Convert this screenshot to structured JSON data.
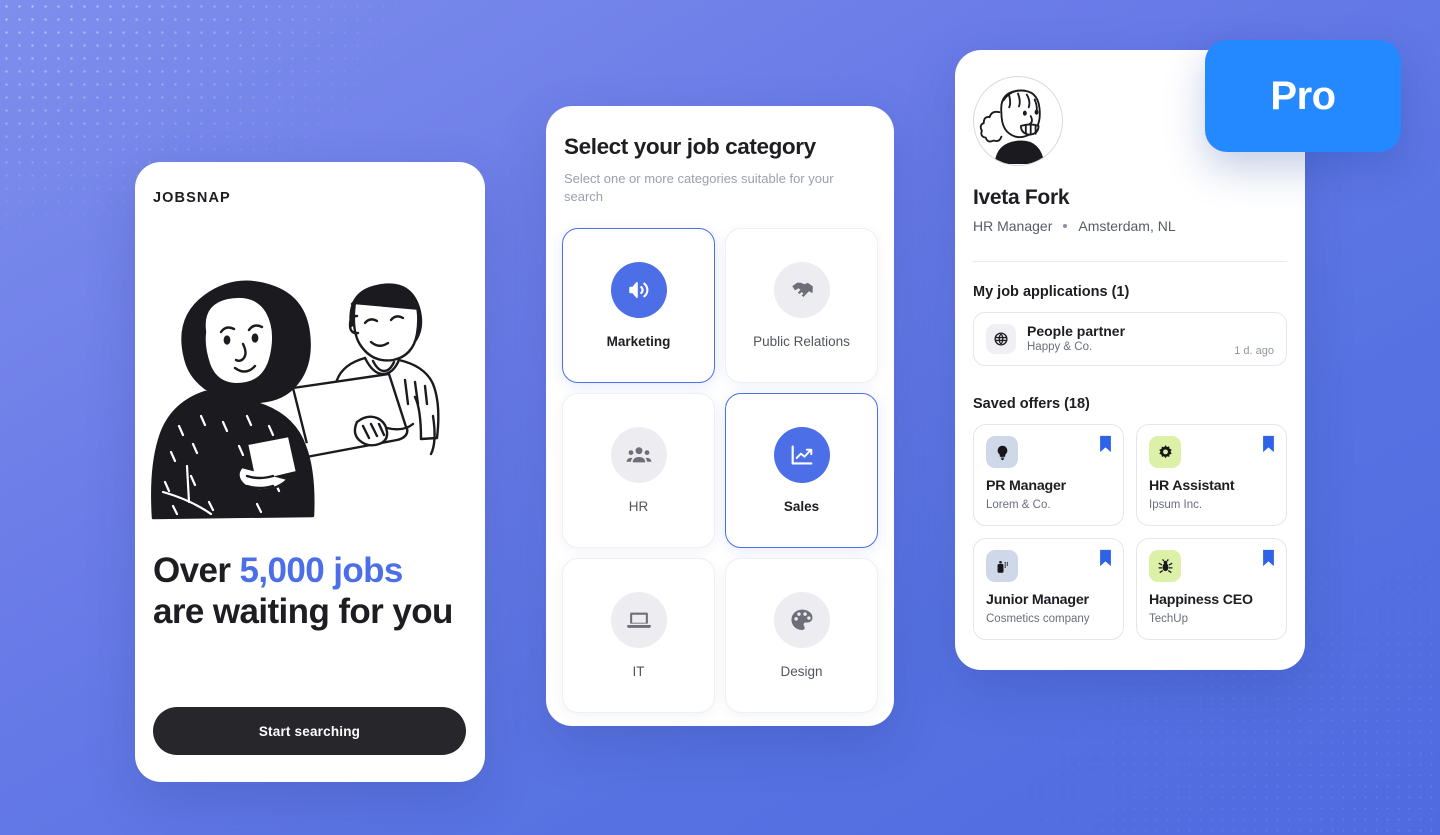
{
  "background": {
    "color_top": "#7E8EEC",
    "color_bottom": "#4F6ADF"
  },
  "onboarding_panel": {
    "brand": "JOBSNAP",
    "illustration_name": "two-people-with-laptop-illustration",
    "headline_before": "Over ",
    "headline_highlight": "5,000 jobs",
    "headline_after": " are waiting for you",
    "headline_highlight_color": "#4C6FE7",
    "cta_label": "Start searching"
  },
  "category_panel": {
    "title": "Select your job category",
    "subtitle": "Select one or more categories suitable for your search",
    "accent_color": "#4C6FE7",
    "categories": [
      {
        "label": "Marketing",
        "icon": "megaphone-icon",
        "selected": true
      },
      {
        "label": "Public Relations",
        "icon": "handshake-icon",
        "selected": false
      },
      {
        "label": "HR",
        "icon": "people-group-icon",
        "selected": false
      },
      {
        "label": "Sales",
        "icon": "chart-growth-icon",
        "selected": true
      },
      {
        "label": "IT",
        "icon": "laptop-icon",
        "selected": false
      },
      {
        "label": "Design",
        "icon": "paint-palette-icon",
        "selected": false
      }
    ]
  },
  "profile_panel": {
    "pro_badge": "Pro",
    "pro_badge_color": "#2488FF",
    "avatar_name": "user-avatar",
    "name": "Iveta Fork",
    "role": "HR Manager",
    "location": "Amsterdam, NL",
    "applications_title": "My job applications (1)",
    "applications": [
      {
        "role": "People partner",
        "company": "Happy & Co.",
        "time": "1 d. ago",
        "logo": "globe-grid-icon",
        "logo_bg": "#EFEFF4"
      }
    ],
    "saved_title": "Saved offers (18)",
    "saved_offers": [
      {
        "role": "PR Manager",
        "company": "Lorem & Co.",
        "icon": "lightbulb-icon",
        "icon_bg": "#CFD8E8",
        "bookmarked": true
      },
      {
        "role": "HR Assistant",
        "company": "Ipsum Inc.",
        "icon": "gear-icon",
        "icon_bg": "#DDF0A8",
        "bookmarked": true
      },
      {
        "role": "Junior Manager",
        "company": "Cosmetics company",
        "icon": "bottle-icon",
        "icon_bg": "#CFD8E8",
        "bookmarked": true
      },
      {
        "role": "Happiness CEO",
        "company": "TechUp",
        "icon": "bug-icon",
        "icon_bg": "#DDF0A8",
        "bookmarked": true
      }
    ],
    "bookmark_color": "#2E63E8"
  }
}
